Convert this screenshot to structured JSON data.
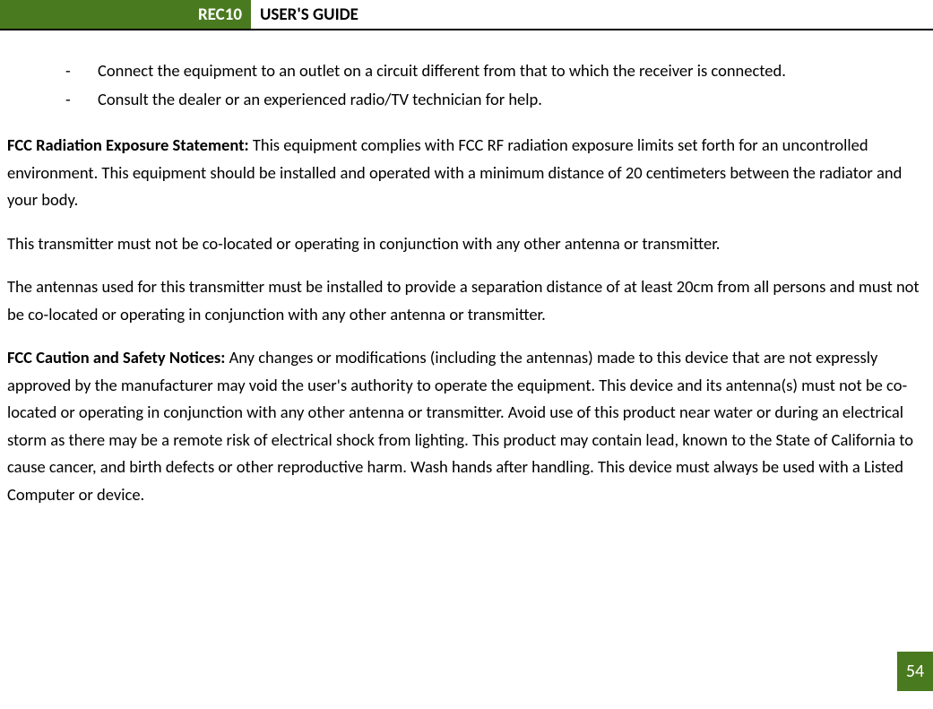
{
  "header": {
    "tab": "REC10",
    "title": "USER'S GUIDE"
  },
  "bullets": {
    "b1": "Connect the equipment to an outlet on a circuit different from that to which the receiver is connected.",
    "b2": "Consult the dealer or an experienced radio/TV technician for help."
  },
  "sections": {
    "fccRadHeading": "FCC Radiation Exposure Statement: ",
    "fccRadBody": "This equipment complies with FCC RF radiation exposure limits set forth for an uncontrolled environment.  This equipment should be installed and operated with a minimum distance of 20 centimeters between the radiator and your body.",
    "transmitter1": "This transmitter must not be co-located or operating in conjunction with any other antenna or transmitter.",
    "antennas": "The antennas used for this transmitter must be installed to provide a separation distance of at least 20cm from all persons and must not be co-located or operating in conjunction with any other antenna or transmitter.",
    "fccCautionHeading": "FCC Caution and Safety Notices: ",
    "fccCautionBody": "Any changes or modifications (including the antennas) made to this device that are not expressly approved by the manufacturer may void the user's authority to operate the equipment.  This device and its antenna(s) must not be co-located or operating in conjunction with any other antenna or transmitter.  Avoid use of this product near water or during an electrical storm as there may be a remote risk of electrical shock from lighting.  This product may contain lead, known to the State of California to cause cancer, and birth defects or other reproductive harm.  Wash hands after handling.  This device must always be used with a Listed Computer or device."
  },
  "pageNumber": "54"
}
